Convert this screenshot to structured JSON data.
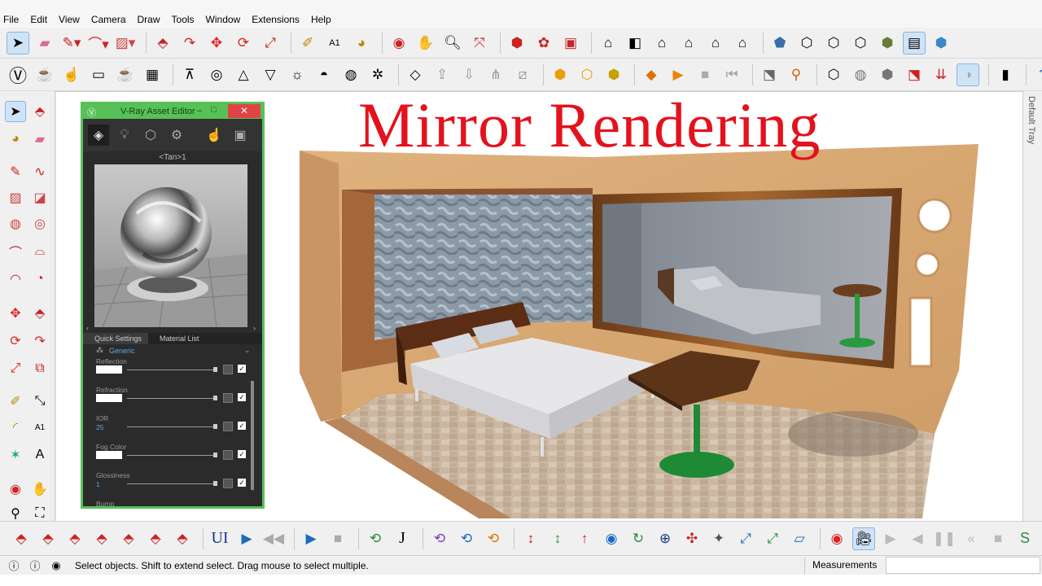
{
  "menu": [
    "File",
    "Edit",
    "View",
    "Camera",
    "Draw",
    "Tools",
    "Window",
    "Extensions",
    "Help"
  ],
  "overlay_title": "Mirror Rendering",
  "right_tray_label": "Default Tray",
  "vray": {
    "title": "V-Ray Asset Editor",
    "material_name": "<Tan>1",
    "tabs": [
      "Quick Settings",
      "Material List"
    ],
    "material_type": "Generic",
    "params": [
      {
        "label": "Reflection",
        "value": ""
      },
      {
        "label": "Refraction",
        "value": ""
      },
      {
        "label": "IOR",
        "value": "25"
      },
      {
        "label": "Fog Color",
        "value": ""
      },
      {
        "label": "Glossiness",
        "value": "1"
      },
      {
        "label": "Bump",
        "value": ""
      }
    ]
  },
  "toolbar_text": {
    "ui_label": "UI",
    "j_label": "J",
    "s_label1": "S",
    "s_label2": "S"
  },
  "status": {
    "hint": "Select objects. Shift to extend select. Drag mouse to select multiple.",
    "measurements_label": "Measurements"
  },
  "colors": {
    "title_red": "#e3121d",
    "vray_green": "#57c157",
    "mirror_frame": "#7a4a22",
    "wall_wood": "#d9a671"
  }
}
